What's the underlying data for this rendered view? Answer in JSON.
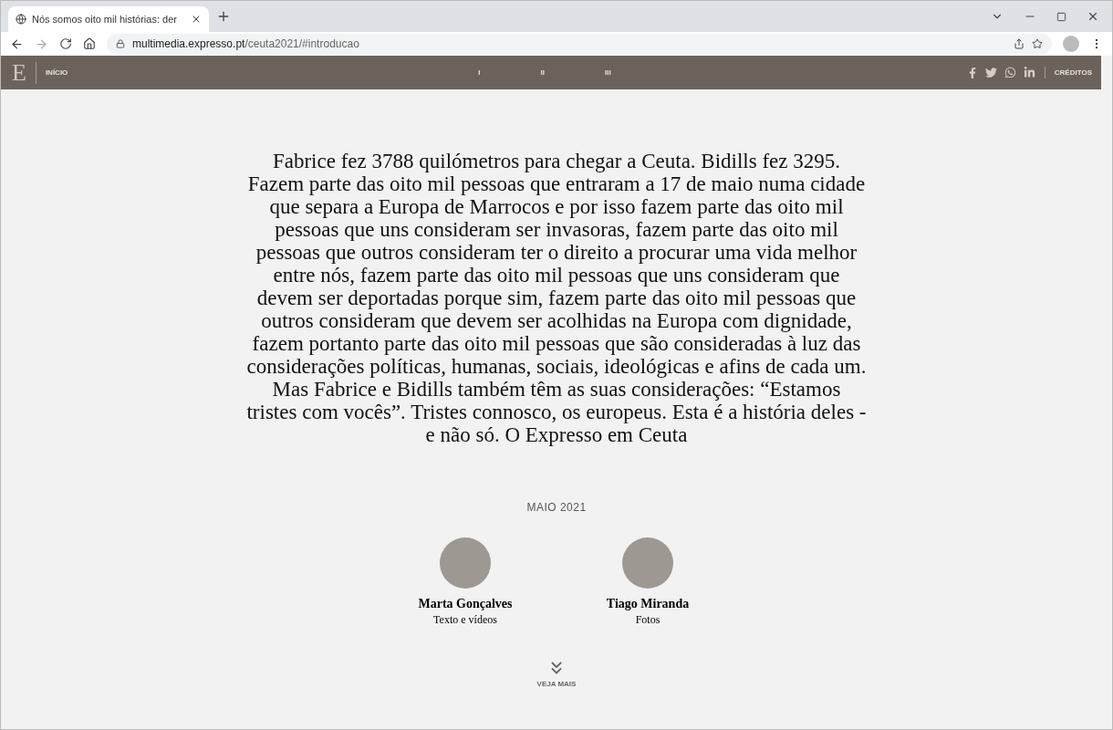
{
  "browser": {
    "tab_title": "Nós somos oito mil histórias: der",
    "url_host": "multimedia.expresso.pt",
    "url_path": "/ceuta2021/#introducao"
  },
  "site_nav": {
    "logo": "E",
    "home": "INÍCIO",
    "chapters": [
      "I",
      "II",
      "III"
    ],
    "credits": "CRÉDITOS"
  },
  "intro": "Fabrice fez 3788 quilómetros para chegar a Ceuta. Bidills fez 3295. Fazem parte das oito mil pessoas que entraram a 17 de maio numa cidade que separa a Europa de Marrocos e por isso fazem parte das oito mil pessoas que uns consideram ser invasoras, fazem parte das oito mil pessoas que outros consideram ter o direito a procurar uma vida melhor entre nós, fazem parte das oito mil pessoas que uns consideram que devem ser deportadas porque sim, fazem parte das oito mil pessoas que outros consideram que devem ser acolhidas na Europa com dignidade, fazem portanto parte das oito mil pessoas que são consideradas à luz das considerações políticas, humanas, sociais, ideológicas e afins de cada um. Mas Fabrice e Bidills também têm as suas considerações: “Estamos tristes com vocês”. Tristes connosco, os europeus. Esta é a história deles - e não só. O Expresso em Ceuta",
  "date": "MAIO 2021",
  "authors": [
    {
      "name": "Marta Gonçalves",
      "role": "Texto e vídeos"
    },
    {
      "name": "Tiago Miranda",
      "role": "Fotos"
    }
  ],
  "more": "VEJA MAIS"
}
